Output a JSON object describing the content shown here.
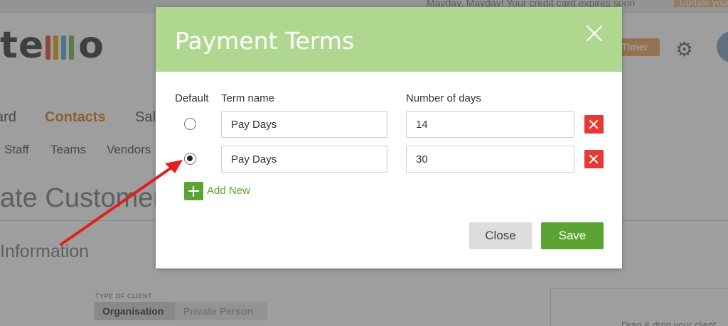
{
  "background": {
    "notice": "Mayday, Mayday! Your credit card expires soon",
    "update_button": "Update your",
    "logo_text_a": "te",
    "logo_text_b": "o",
    "logo_bar_colors": [
      "#e57368",
      "#f0b548",
      "#7cc0d8",
      "#90c67a"
    ],
    "timer_button": "Timer",
    "nav_main": [
      "ard",
      "Contacts",
      "Sal"
    ],
    "nav_sub": [
      "Staff",
      "Teams",
      "Vendors"
    ],
    "page_title": "ate Customer:",
    "section_title": "Information",
    "type_of_client_label": "TYPE OF CLIENT",
    "type_options": [
      "Organisation",
      "Private Person"
    ],
    "drop_text": "Drag & drop your client"
  },
  "modal": {
    "title": "Payment Terms",
    "columns": {
      "default": "Default",
      "term_name": "Term name",
      "days": "Number of days"
    },
    "rows": [
      {
        "selected": false,
        "term_name": "Pay Days",
        "days": "14"
      },
      {
        "selected": true,
        "term_name": "Pay Days",
        "days": "30"
      }
    ],
    "add_new_label": "Add New",
    "close_label": "Close",
    "save_label": "Save"
  },
  "colors": {
    "header_green": "#b0d78f",
    "accent_green": "#5ba434",
    "delete_red": "#e53935",
    "annotation_red": "#e02020"
  }
}
